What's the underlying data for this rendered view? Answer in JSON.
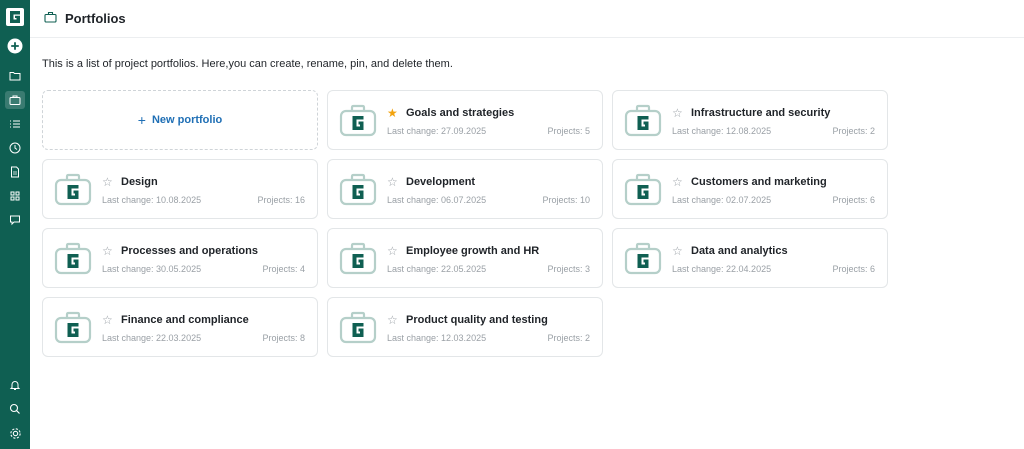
{
  "header": {
    "title": "Portfolios",
    "icon": "briefcase-icon"
  },
  "description": "This is a list of project portfolios. Here,you can create, rename, pin, and delete them.",
  "new_portfolio_label": "New portfolio",
  "meta_labels": {
    "last_change": "Last change:",
    "projects": "Projects:"
  },
  "sidebar": {
    "logo": "G",
    "top_icons": [
      "add-circle-icon",
      "folder-icon",
      "briefcase-icon",
      "list-icon",
      "clock-icon",
      "document-icon",
      "grid-icon",
      "chat-icon"
    ],
    "bottom_icons": [
      "bell-icon",
      "search-icon",
      "gear-icon"
    ],
    "active": "briefcase-icon"
  },
  "colors": {
    "sidebar": "#0f5f52",
    "accent": "#1f6fb5",
    "pinned_star": "#f2a30f",
    "icon_green": "#0f5f52"
  },
  "portfolios": [
    {
      "name": "Goals and strategies",
      "pinned": true,
      "last_change": "Last change: 27.09.2025",
      "projects": "Projects: 5"
    },
    {
      "name": "Infrastructure and security",
      "pinned": false,
      "last_change": "Last change: 12.08.2025",
      "projects": "Projects: 2"
    },
    {
      "name": "Design",
      "pinned": false,
      "last_change": "Last change: 10.08.2025",
      "projects": "Projects: 16"
    },
    {
      "name": "Development",
      "pinned": false,
      "last_change": "Last change: 06.07.2025",
      "projects": "Projects: 10"
    },
    {
      "name": "Customers and marketing",
      "pinned": false,
      "last_change": "Last change: 02.07.2025",
      "projects": "Projects: 6"
    },
    {
      "name": "Processes and operations",
      "pinned": false,
      "last_change": "Last change: 30.05.2025",
      "projects": "Projects: 4"
    },
    {
      "name": "Employee growth and HR",
      "pinned": false,
      "last_change": "Last change: 22.05.2025",
      "projects": "Projects: 3"
    },
    {
      "name": "Data and analytics",
      "pinned": false,
      "last_change": "Last change: 22.04.2025",
      "projects": "Projects: 6"
    },
    {
      "name": "Finance and compliance",
      "pinned": false,
      "last_change": "Last change: 22.03.2025",
      "projects": "Projects: 8"
    },
    {
      "name": "Product quality and testing",
      "pinned": false,
      "last_change": "Last change: 12.03.2025",
      "projects": "Projects: 2"
    }
  ]
}
